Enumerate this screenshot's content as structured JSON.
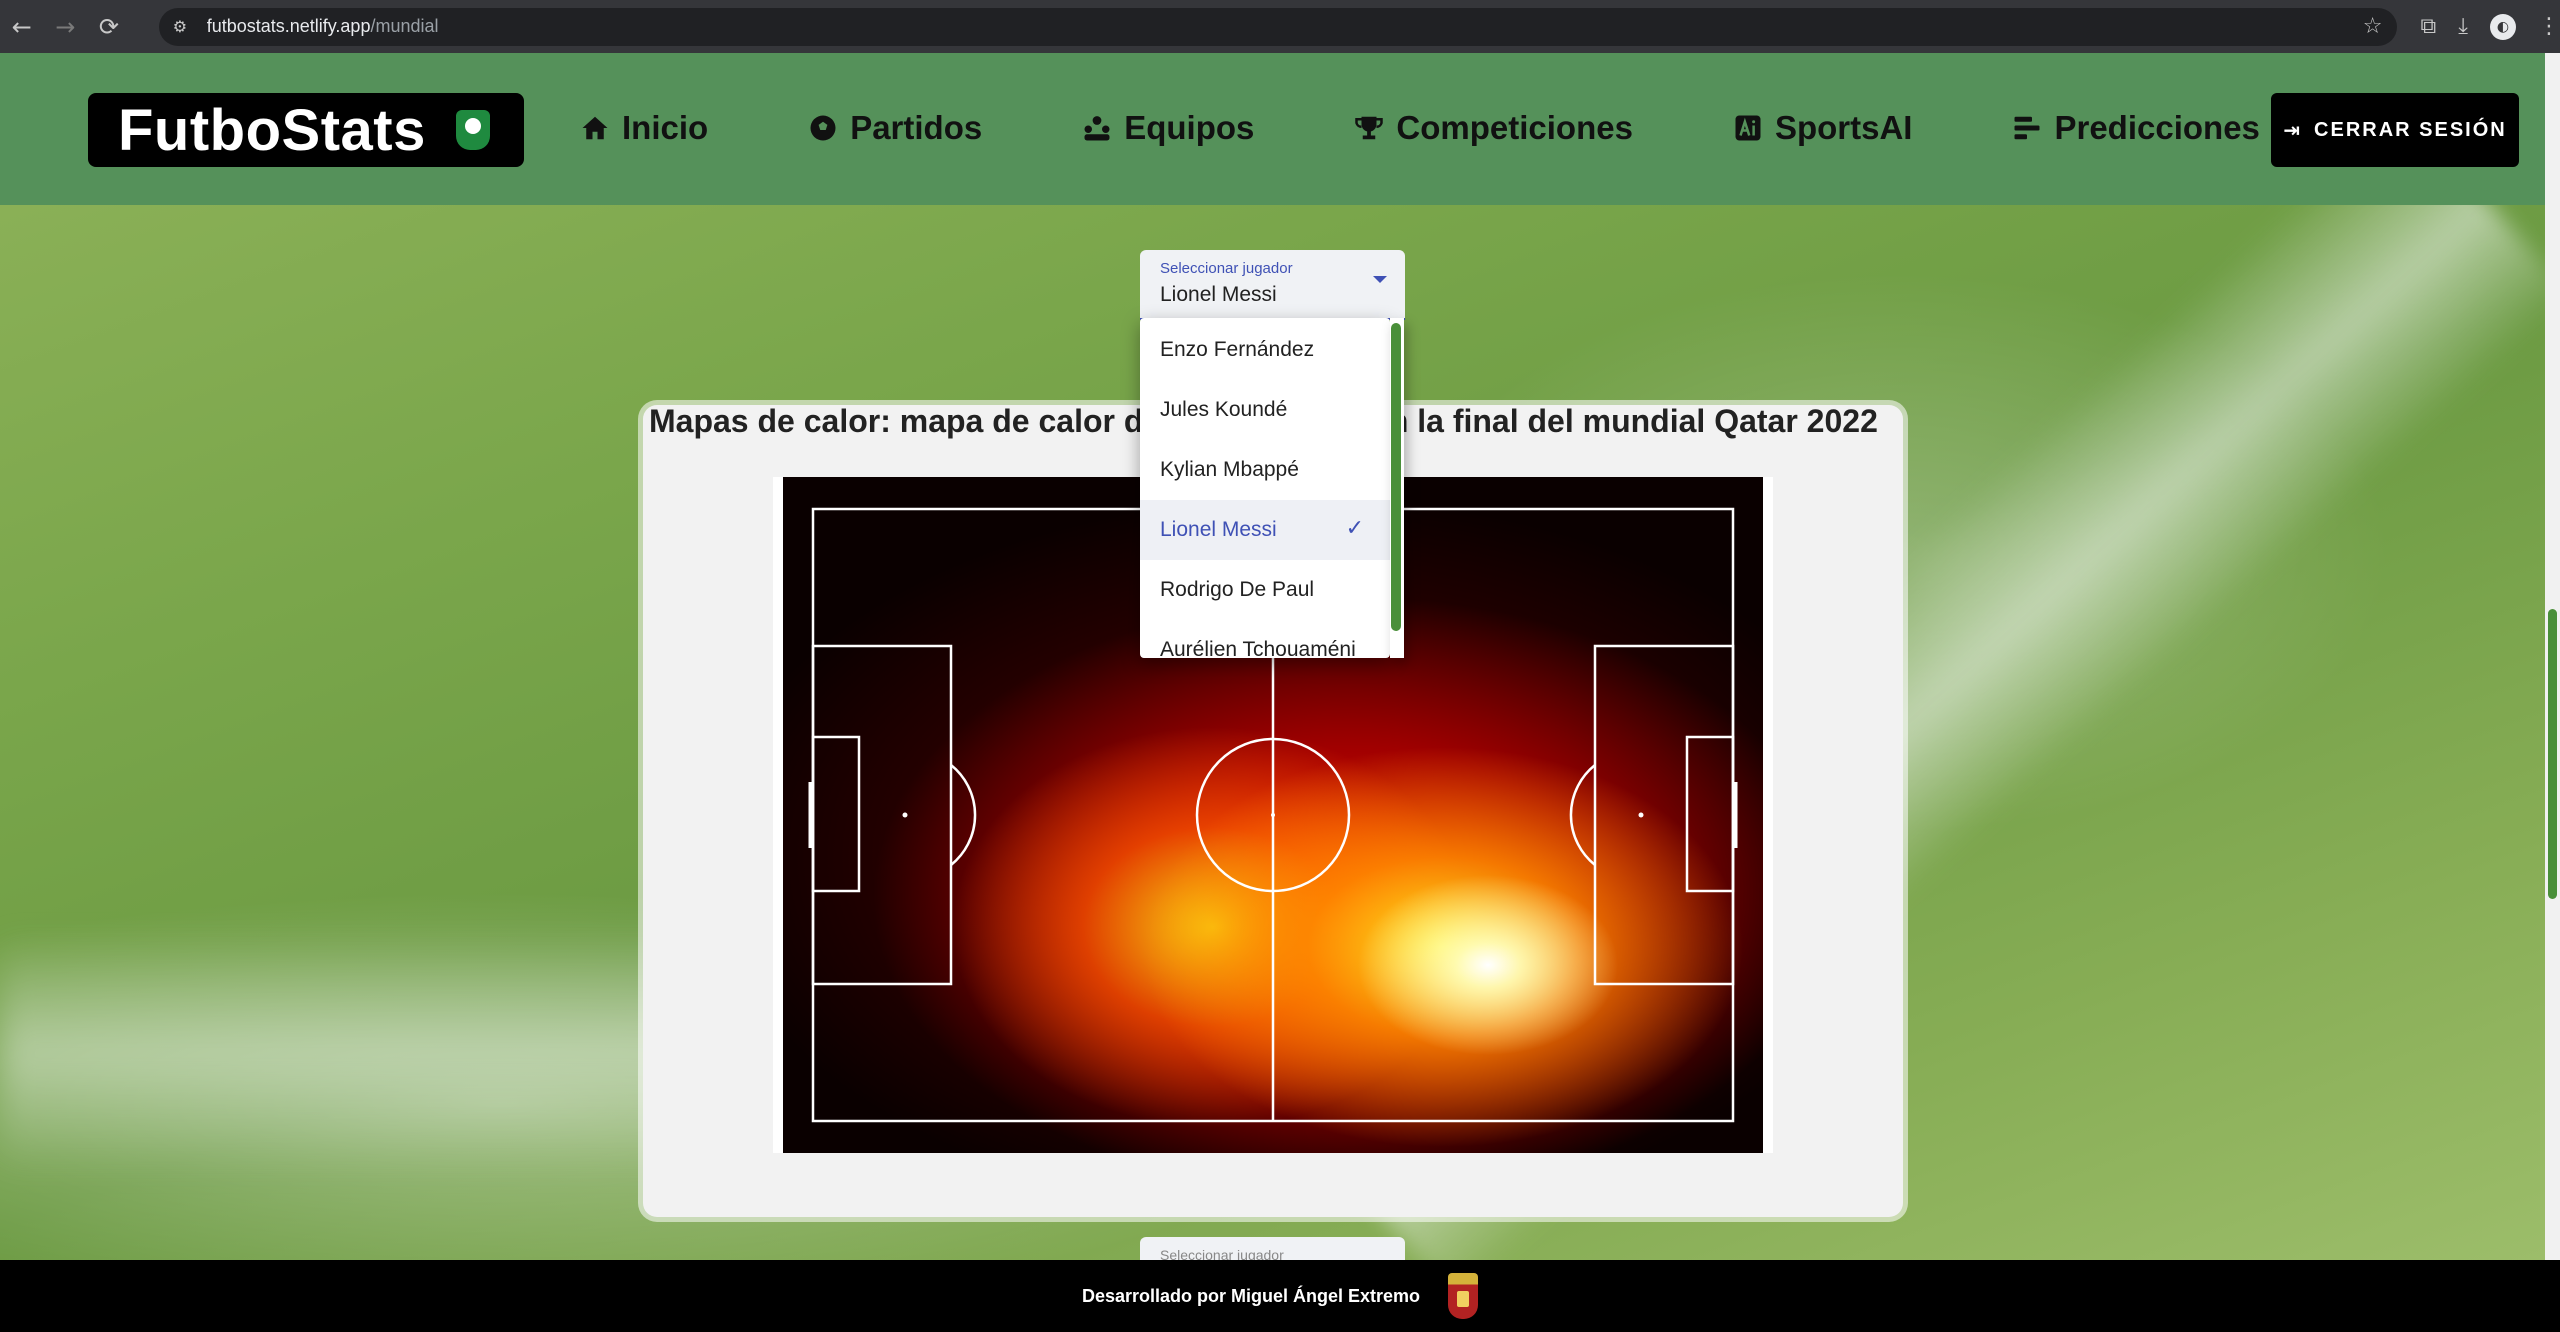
{
  "browser": {
    "url_host": "futbostats.netlify.app",
    "url_path": "/mundial",
    "back_icon": "←",
    "forward_icon": "→",
    "reload_icon": "⟳",
    "site_info_icon": "⚙",
    "star_icon": "☆",
    "extensions_icon": "⧉",
    "download_icon": "⤓",
    "profile_icon": "◐",
    "menu_icon": "⋮"
  },
  "header": {
    "brand": "FutboStats",
    "nav": [
      {
        "label": "Inicio",
        "icon": "home-icon"
      },
      {
        "label": "Partidos",
        "icon": "soccer-ball-icon"
      },
      {
        "label": "Equipos",
        "icon": "teams-icon"
      },
      {
        "label": "Competiciones",
        "icon": "trophy-icon"
      },
      {
        "label": "SportsAI",
        "icon": "ai-icon"
      },
      {
        "label": "Predicciones",
        "icon": "bars-icon"
      }
    ],
    "logout_label": "CERRAR SESIÓN",
    "logout_icon": "⇥"
  },
  "player_select": {
    "label": "Seleccionar jugador",
    "value": "Lionel Messi",
    "options": [
      "Enzo Fernández",
      "Jules Koundé",
      "Kylian Mbappé",
      "Lionel Messi",
      "Rodrigo De Paul",
      "Aurélien Tchouaméni"
    ],
    "selected_index": 3,
    "check_icon": "✓"
  },
  "heatmap_card": {
    "title": "Mapas de calor: mapa de calor de Lionel Messi en la final del mundial Qatar 2022"
  },
  "second_select": {
    "label": "Seleccionar jugador"
  },
  "footer": {
    "text": "Desarrollado por Miguel Ángel Extremo"
  },
  "colors": {
    "header_green": "#55915a",
    "accent_blue": "#3f51b5",
    "scroll_green": "#4a8f3a"
  }
}
